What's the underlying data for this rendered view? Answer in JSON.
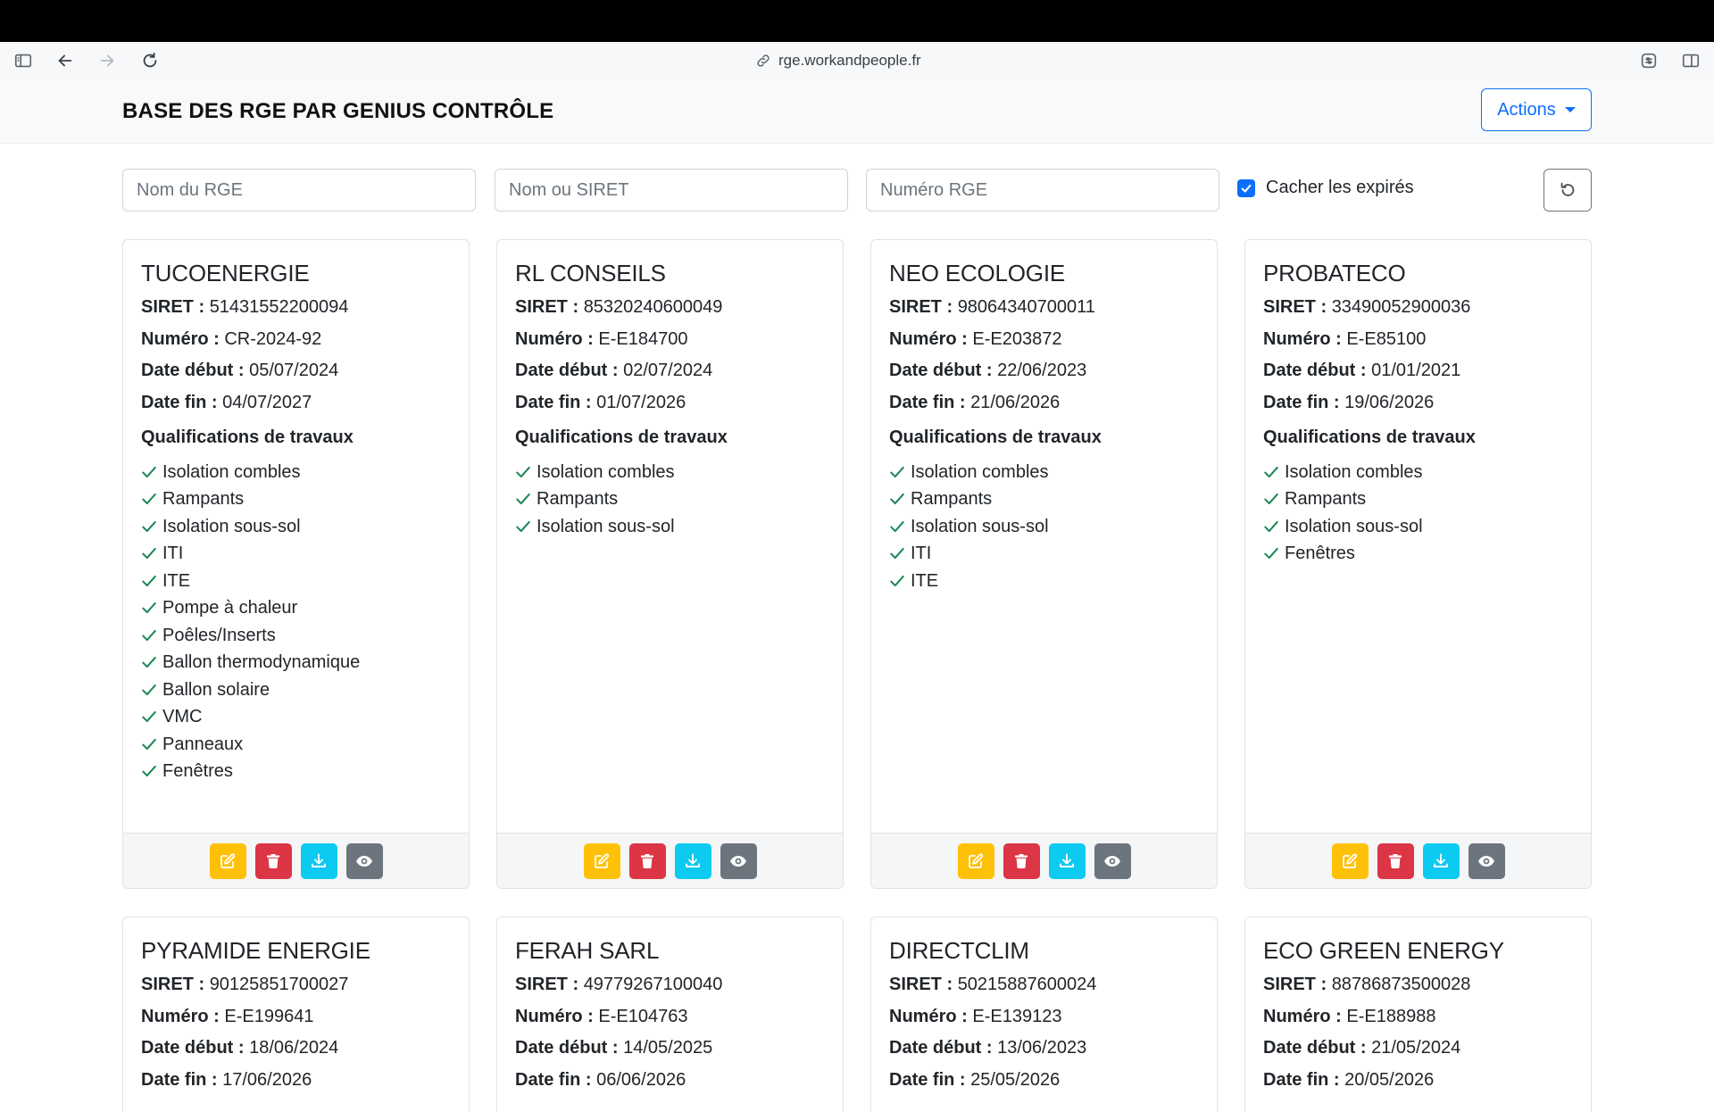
{
  "browser": {
    "url": "rge.workandpeople.fr"
  },
  "navbar": {
    "brand": "BASE DES RGE PAR GENIUS CONTRÔLE",
    "actions_label": "Actions"
  },
  "filters": {
    "name_placeholder": "Nom du RGE",
    "siret_placeholder": "Nom ou SIRET",
    "number_placeholder": "Numéro RGE",
    "hide_expired_label": "Cacher les expirés",
    "hide_expired_checked": true
  },
  "labels": {
    "siret": "SIRET :",
    "numero": "Numéro :",
    "date_debut": "Date début :",
    "date_fin": "Date fin :",
    "qualifications": "Qualifications de travaux"
  },
  "colors": {
    "primary": "#0d6efd",
    "check": "#198754",
    "edit": "#ffc107",
    "delete": "#dc3545",
    "download": "#0dcaf0",
    "view": "#6c757d"
  },
  "cards": [
    {
      "name": "TUCOENERGIE",
      "siret": "51431552200094",
      "numero": "CR-2024-92",
      "date_debut": "05/07/2024",
      "date_fin": "04/07/2027",
      "qualifications": [
        "Isolation combles",
        "Rampants",
        "Isolation sous-sol",
        "ITI",
        "ITE",
        "Pompe à chaleur",
        "Poêles/Inserts",
        "Ballon thermodynamique",
        "Ballon solaire",
        "VMC",
        "Panneaux",
        "Fenêtres"
      ]
    },
    {
      "name": "RL CONSEILS",
      "siret": "85320240600049",
      "numero": "E-E184700",
      "date_debut": "02/07/2024",
      "date_fin": "01/07/2026",
      "qualifications": [
        "Isolation combles",
        "Rampants",
        "Isolation sous-sol"
      ]
    },
    {
      "name": "NEO ECOLOGIE",
      "siret": "98064340700011",
      "numero": "E-E203872",
      "date_debut": "22/06/2023",
      "date_fin": "21/06/2026",
      "qualifications": [
        "Isolation combles",
        "Rampants",
        "Isolation sous-sol",
        "ITI",
        "ITE"
      ]
    },
    {
      "name": "PROBATECO",
      "siret": "33490052900036",
      "numero": "E-E85100",
      "date_debut": "01/01/2021",
      "date_fin": "19/06/2026",
      "qualifications": [
        "Isolation combles",
        "Rampants",
        "Isolation sous-sol",
        "Fenêtres"
      ]
    },
    {
      "name": "PYRAMIDE ENERGIE",
      "siret": "90125851700027",
      "numero": "E-E199641",
      "date_debut": "18/06/2024",
      "date_fin": "17/06/2026",
      "qualifications": []
    },
    {
      "name": "FERAH SARL",
      "siret": "49779267100040",
      "numero": "E-E104763",
      "date_debut": "14/05/2025",
      "date_fin": "06/06/2026",
      "qualifications": []
    },
    {
      "name": "DIRECTCLIM",
      "siret": "50215887600024",
      "numero": "E-E139123",
      "date_debut": "13/06/2023",
      "date_fin": "25/05/2026",
      "qualifications": []
    },
    {
      "name": "ECO GREEN ENERGY",
      "siret": "88786873500028",
      "numero": "E-E188988",
      "date_debut": "21/05/2024",
      "date_fin": "20/05/2026",
      "qualifications": []
    }
  ]
}
